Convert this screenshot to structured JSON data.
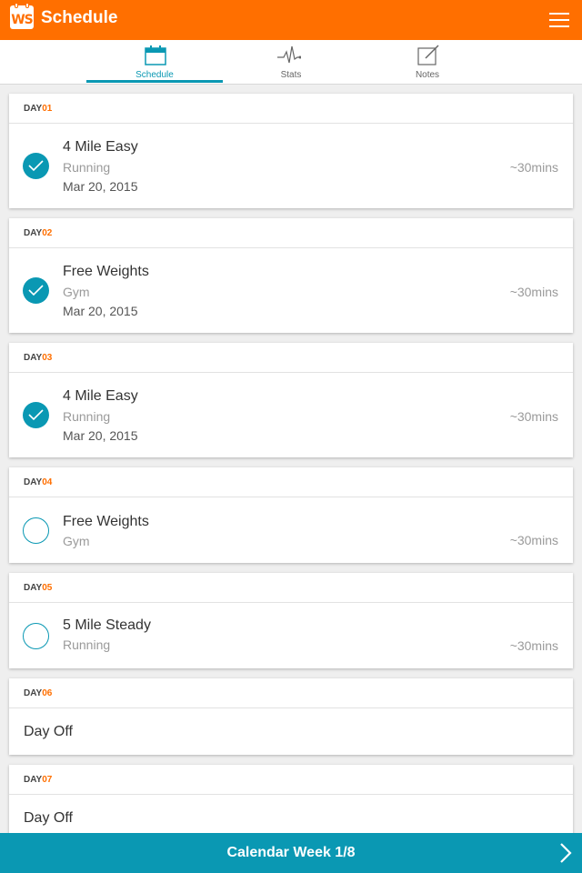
{
  "app": {
    "title": "Schedule",
    "logo_text": "WS"
  },
  "tabs": [
    {
      "label": "Schedule",
      "icon": "calendar-icon",
      "active": true
    },
    {
      "label": "Stats",
      "icon": "pulse-icon",
      "active": false
    },
    {
      "label": "Notes",
      "icon": "note-edit-icon",
      "active": false
    }
  ],
  "days": [
    {
      "prefix": "DAY",
      "num": "01",
      "title": "4 Mile Easy",
      "type": "Running",
      "date": "Mar 20, 2015",
      "duration": "~30mins",
      "done": true
    },
    {
      "prefix": "DAY",
      "num": "02",
      "title": "Free Weights",
      "type": "Gym",
      "date": "Mar 20, 2015",
      "duration": "~30mins",
      "done": true
    },
    {
      "prefix": "DAY",
      "num": "03",
      "title": "4 Mile Easy",
      "type": "Running",
      "date": "Mar 20, 2015",
      "duration": "~30mins",
      "done": true
    },
    {
      "prefix": "DAY",
      "num": "04",
      "title": "Free Weights",
      "type": "Gym",
      "duration": "~30mins",
      "done": false
    },
    {
      "prefix": "DAY",
      "num": "05",
      "title": "5 Mile Steady",
      "type": "Running",
      "duration": "~30mins",
      "done": false
    },
    {
      "prefix": "DAY",
      "num": "06",
      "off_label": "Day Off"
    },
    {
      "prefix": "DAY",
      "num": "07",
      "off_label": "Day Off"
    }
  ],
  "footer": {
    "label": "Calendar Week 1/8"
  },
  "colors": {
    "accent": "#ff6f00",
    "primary": "#0a98b3"
  }
}
